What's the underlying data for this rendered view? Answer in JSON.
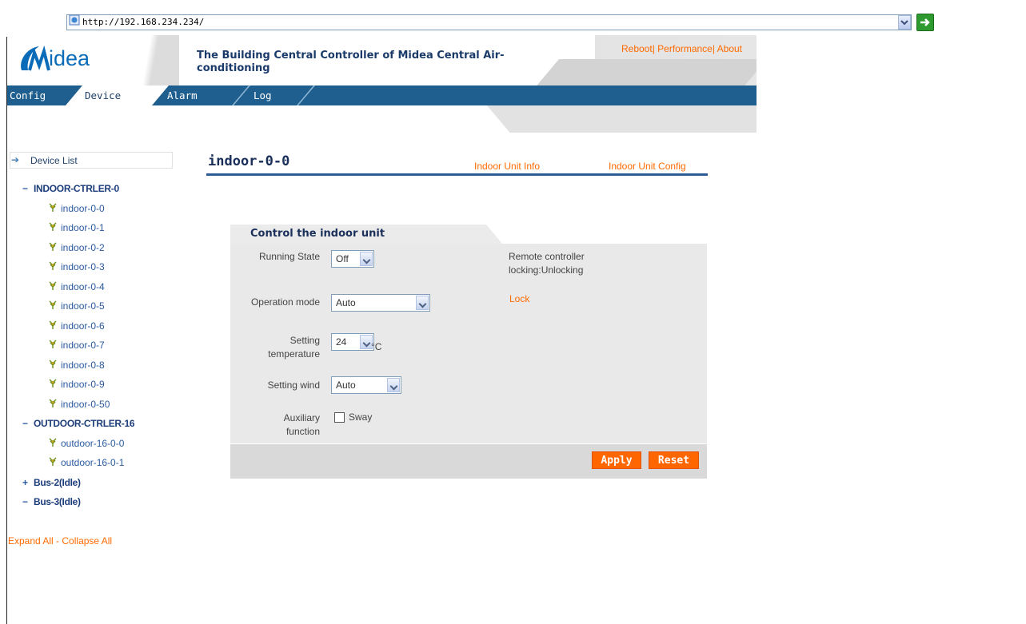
{
  "browser": {
    "url": "http://192.168.234.234/"
  },
  "header": {
    "logo_text": "idea",
    "title": "The Building Central Controller of Midea Central Air-conditioning",
    "links": [
      "Reboot",
      "Performance",
      "About"
    ]
  },
  "nav": {
    "tabs": [
      "Config",
      "Device",
      "Alarm",
      "Log"
    ],
    "active": "Device"
  },
  "sidebar": {
    "header": "Device List",
    "groups": [
      {
        "label": "INDOOR-CTRLER-0",
        "toggle": "−",
        "items": [
          "indoor-0-0",
          "indoor-0-1",
          "indoor-0-2",
          "indoor-0-3",
          "indoor-0-4",
          "indoor-0-5",
          "indoor-0-6",
          "indoor-0-7",
          "indoor-0-8",
          "indoor-0-9",
          "indoor-0-50"
        ]
      },
      {
        "label": "OUTDOOR-CTRLER-16",
        "toggle": "−",
        "items": [
          "outdoor-16-0-0",
          "outdoor-16-0-1"
        ]
      },
      {
        "label": "Bus-2(Idle)",
        "toggle": "+",
        "items": []
      },
      {
        "label": "Bus-3(Idle)",
        "toggle": "−",
        "items": []
      }
    ],
    "expand_all": "Expand All",
    "separator": " - ",
    "collapse_all": "Collapse All"
  },
  "main": {
    "device_name": "indoor-0-0",
    "links": {
      "info": "Indoor Unit Info",
      "config": "Indoor Unit Config"
    },
    "panel": {
      "title": "Control the indoor unit",
      "running_state_label": "Running State",
      "running_state_value": "Off",
      "operation_mode_label": "Operation mode",
      "operation_mode_value": "Auto",
      "setting_temp_label": "Setting temperature",
      "setting_temp_value": "24",
      "temp_unit": "°C",
      "setting_wind_label": "Setting wind",
      "setting_wind_value": "Auto",
      "aux_label": "Auxiliary function",
      "sway_label": "Sway",
      "remote_lock_status": "Remote controller locking:Unlocking",
      "lock_link": "Lock",
      "apply_label": "Apply",
      "reset_label": "Reset"
    }
  },
  "colors": {
    "accent_orange": "#ff6a00",
    "nav_blue": "#1f5f8f",
    "brand_blue": "#0a6cb8"
  }
}
